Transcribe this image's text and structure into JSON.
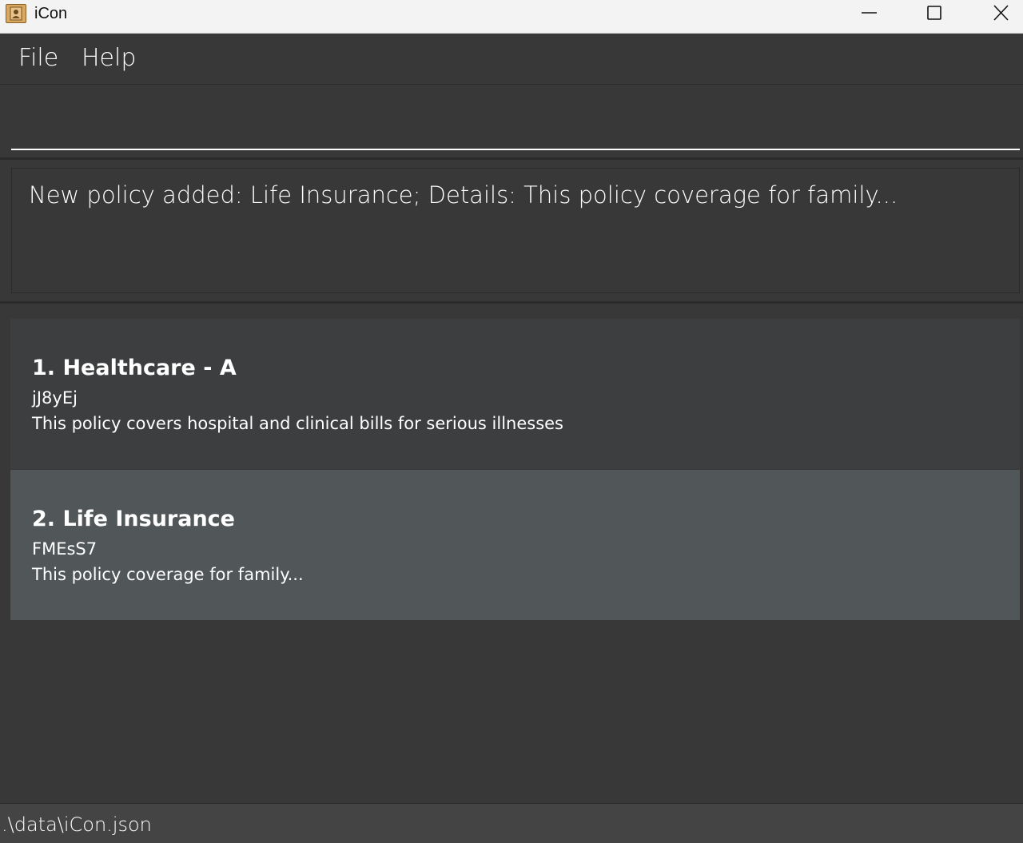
{
  "window": {
    "title": "iCon"
  },
  "menu": {
    "file_label": "File",
    "help_label": "Help"
  },
  "command": {
    "value": ""
  },
  "result": {
    "message": "New policy added: Life Insurance; Details: This policy coverage for family..."
  },
  "policies": [
    {
      "title": "1. Healthcare - A",
      "id": "jJ8yEj",
      "description": "This policy covers hospital and clinical bills for serious illnesses"
    },
    {
      "title": "2. Life Insurance",
      "id": "FMEsS7",
      "description": "This policy coverage for family..."
    }
  ],
  "status": {
    "file_path": ".\\data\\iCon.json"
  },
  "colors": {
    "background": "#383838",
    "selected_card": "#515658",
    "card": "#3c3e3f",
    "text": "#ffffff",
    "titlebar": "#f3f3f3"
  },
  "icons": {
    "app": "contact-book-icon",
    "minimize": "minimize-icon",
    "maximize": "maximize-icon",
    "close": "close-icon"
  }
}
